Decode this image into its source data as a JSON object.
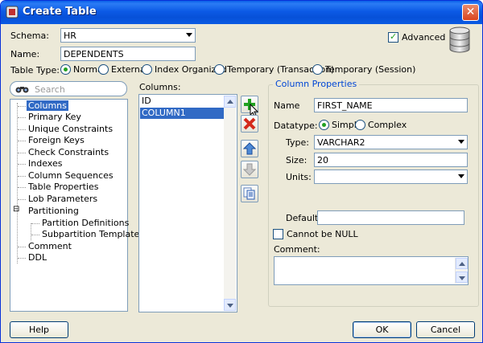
{
  "window": {
    "title": "Create Table"
  },
  "schema": {
    "label": "Schema:",
    "value": "HR"
  },
  "name": {
    "label": "Name:",
    "value": "DEPENDENTS"
  },
  "advanced": {
    "label": "Advanced",
    "checked": true
  },
  "table_type": {
    "label": "Table Type:",
    "options": [
      "Normal",
      "External",
      "Index Organized",
      "Temporary (Transaction)",
      "Temporary (Session)"
    ],
    "selected": "Normal"
  },
  "search": {
    "placeholder": "Search"
  },
  "tree": {
    "items": [
      "Columns",
      "Primary Key",
      "Unique Constraints",
      "Foreign Keys",
      "Check Constraints",
      "Indexes",
      "Column Sequences",
      "Table Properties",
      "Lob Parameters",
      "Partitioning",
      "Partition Definitions",
      "Subpartition Templates",
      "Comment",
      "DDL"
    ],
    "selected": "Columns",
    "expander": "⊟"
  },
  "columns": {
    "label": "Columns:",
    "items": [
      "ID",
      "COLUMN1"
    ],
    "selected": "COLUMN1"
  },
  "column_properties": {
    "title": "Column Properties",
    "name_label": "Name",
    "name_value": "FIRST_NAME",
    "datatype_label": "Datatype:",
    "datatype_options": [
      "Simple",
      "Complex"
    ],
    "datatype_selected": "Simple",
    "type_label": "Type:",
    "type_value": "VARCHAR2",
    "size_label": "Size:",
    "size_value": "20",
    "units_label": "Units:",
    "units_value": "",
    "default_label": "Default:",
    "default_value": "",
    "not_null_label": "Cannot be NULL",
    "not_null_checked": false,
    "comment_label": "Comment:",
    "comment_value": ""
  },
  "buttons": {
    "help": "Help",
    "ok": "OK",
    "cancel": "Cancel"
  },
  "colors": {
    "title_bar": "#0a5fe8",
    "selection": "#316ac5",
    "add_green": "#21a121",
    "remove_red": "#d42a1c",
    "group_title": "#0046d5"
  }
}
